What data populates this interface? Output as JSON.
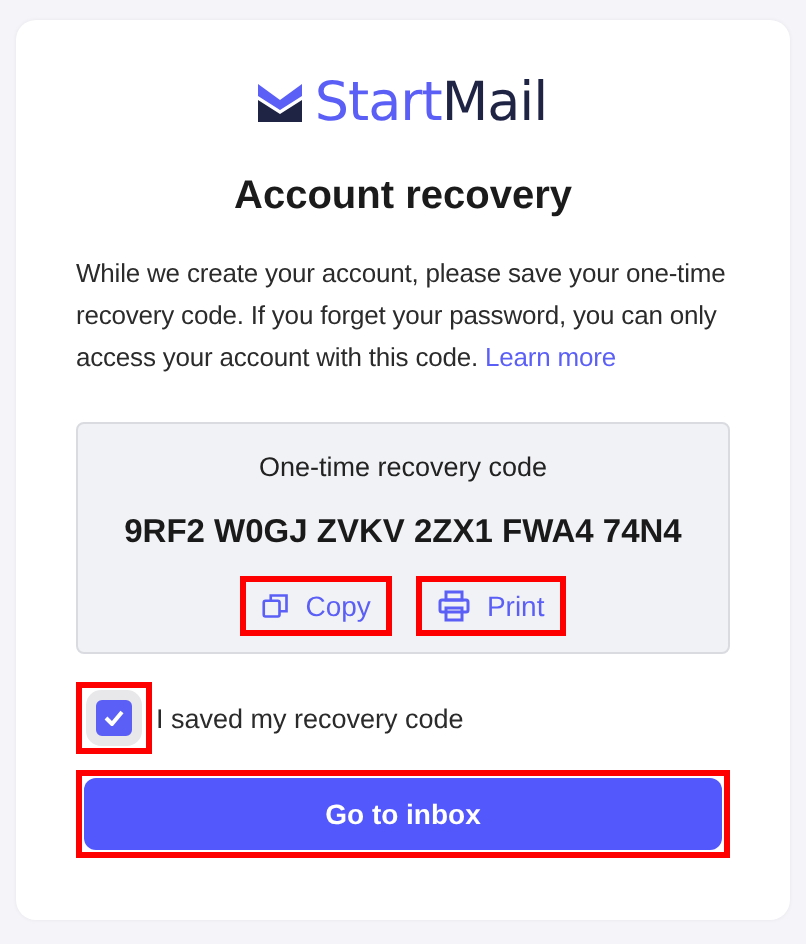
{
  "logo": {
    "first": "Start",
    "second": "Mail"
  },
  "title": "Account recovery",
  "intro": {
    "text": "While we create your account, please save your one-time recovery code. If you forget your password, you can only access your account with this code.",
    "link": "Learn more"
  },
  "code_box": {
    "label": "One-time recovery code",
    "code": "9RF2 W0GJ ZVKV 2ZX1 FWA4 74N4",
    "actions": [
      {
        "kind": "copy",
        "label": "Copy",
        "highlighted": true
      },
      {
        "kind": "print",
        "label": "Print",
        "highlighted": true
      }
    ]
  },
  "confirm": {
    "label": "I saved my recovery code",
    "checked": true,
    "highlighted": true
  },
  "primary_button": {
    "label": "Go to inbox",
    "highlighted": true
  }
}
